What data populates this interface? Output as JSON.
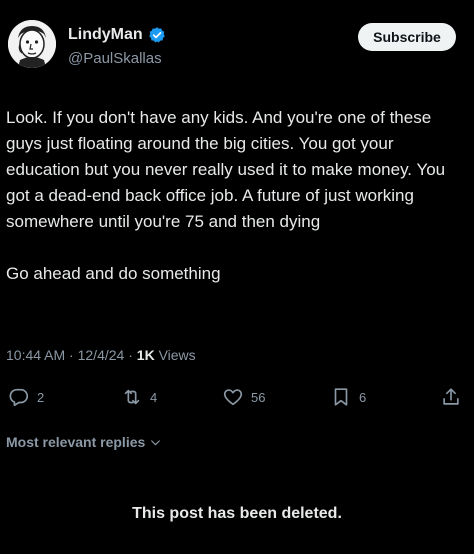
{
  "author": {
    "display_name": "LindyMan",
    "handle": "@PaulSkallas",
    "verified": true,
    "avatar_icon": "cartoon-face-avatar"
  },
  "header": {
    "subscribe_label": "Subscribe"
  },
  "tweet": {
    "paragraphs": [
      "Look. If you don't have any kids. And you're one of these guys just floating around the big cities. You got your education but you never really used it to make money. You got a dead-end back office job. A future of just working somewhere until you're 75 and then dying",
      "Go ahead and do something"
    ],
    "time": "10:44 AM",
    "date": "12/4/24",
    "separator": " · ",
    "views_count": "1K",
    "views_label": "Views"
  },
  "actions": {
    "replies": "2",
    "reposts": "4",
    "likes": "56",
    "bookmarks": "6"
  },
  "replies_filter_label": "Most relevant replies",
  "deleted_notice": "This post has been deleted.",
  "colors": {
    "background": "#000000",
    "text_primary": "#e7e9ea",
    "text_secondary": "#8b98a5",
    "verified_blue": "#1d9bf0",
    "button_bg": "#eff3f4"
  }
}
